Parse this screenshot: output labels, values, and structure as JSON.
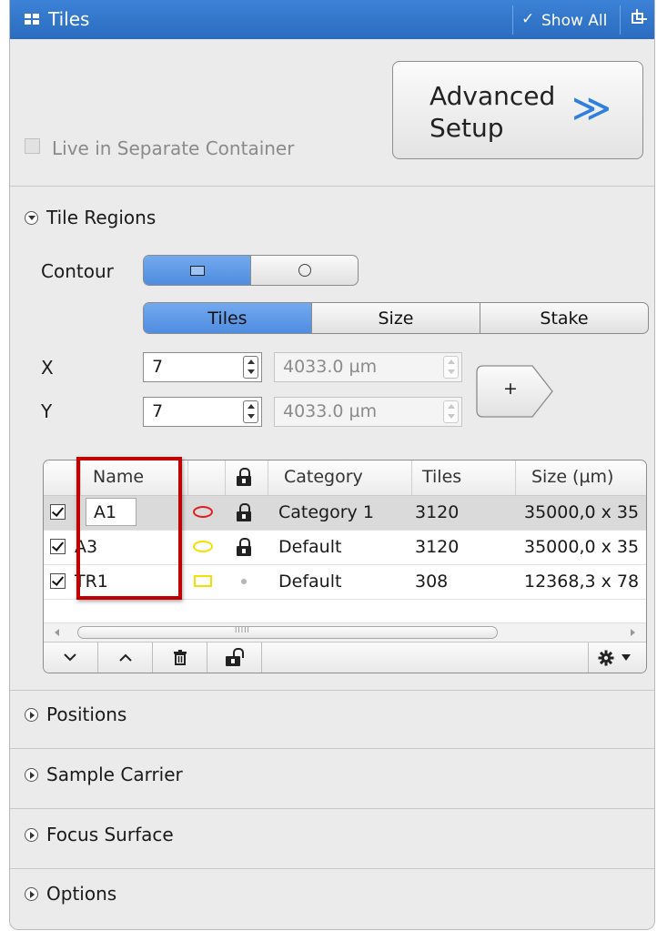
{
  "titlebar": {
    "title": "Tiles",
    "show_all": "Show All",
    "show_all_check": "✓",
    "icons": [
      "tiles-grid-icon",
      "checkmark-icon",
      "undock-icon"
    ]
  },
  "advanced_setup": {
    "label": "Advanced Setup",
    "chevron": "≫",
    "accent_color": "#2f7fe0"
  },
  "live_separate": {
    "label": "Live in Separate Container",
    "checked": false,
    "enabled": false
  },
  "tile_regions": {
    "label": "Tile Regions",
    "expanded": true,
    "contour_label": "Contour",
    "contour_options": [
      "rectangle",
      "circle"
    ],
    "contour_selected": "rectangle",
    "mode_tabs": [
      "Tiles",
      "Size",
      "Stake"
    ],
    "mode_selected": "Tiles",
    "x_label": "X",
    "y_label": "Y",
    "x_tiles": "7",
    "y_tiles": "7",
    "x_size": "4033.0 µm",
    "y_size": "4033.0 µm",
    "add_label": "+",
    "table": {
      "columns": [
        "Name",
        "",
        "",
        "Category",
        "Tiles",
        "Size (µm)"
      ],
      "rows": [
        {
          "checked": true,
          "name": "A1",
          "shape": "ellipse",
          "shape_color": "#e02020",
          "lock": "locked",
          "category": "Category 1",
          "tiles": "3120",
          "size": "35000,0 x 35",
          "selected": true,
          "editing": true
        },
        {
          "checked": true,
          "name": "A3",
          "shape": "ellipse",
          "shape_color": "#f2e100",
          "lock": "locked",
          "category": "Default",
          "tiles": "3120",
          "size": "35000,0 x 35",
          "selected": false,
          "editing": false
        },
        {
          "checked": true,
          "name": "TR1",
          "shape": "rect",
          "shape_color": "#f2e100",
          "lock": "none",
          "category": "Default",
          "tiles": "308",
          "size": "12368,3 x 78",
          "selected": false,
          "editing": false
        }
      ],
      "toolbar": [
        "move-down",
        "move-up",
        "delete",
        "unlock",
        "settings"
      ],
      "scroll_grip": "IIIII"
    },
    "highlight_color": "#c00000"
  },
  "sections": [
    {
      "label": "Positions",
      "expanded": false
    },
    {
      "label": "Sample Carrier",
      "expanded": false
    },
    {
      "label": "Focus Surface",
      "expanded": false
    },
    {
      "label": "Options",
      "expanded": false
    }
  ]
}
